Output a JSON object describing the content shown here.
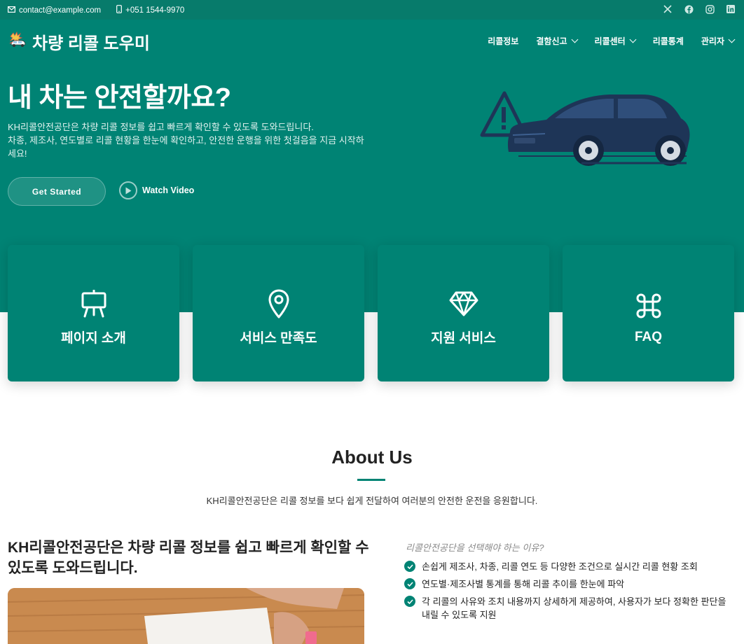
{
  "topbar": {
    "email": "contact@example.com",
    "phone": "+051 1544-9970",
    "social": [
      "x-icon",
      "facebook-icon",
      "instagram-icon",
      "linkedin-icon"
    ]
  },
  "brand": {
    "name": "차량 리콜 도우미",
    "logo_icon": "car-crash-icon"
  },
  "nav": [
    {
      "label": "리콜정보",
      "dropdown": false
    },
    {
      "label": "결함신고",
      "dropdown": true
    },
    {
      "label": "리콜센터",
      "dropdown": true
    },
    {
      "label": "리콜통계",
      "dropdown": false
    },
    {
      "label": "관리자",
      "dropdown": true
    }
  ],
  "hero": {
    "title": "내 차는 안전할까요?",
    "desc_line1": "KH리콜안전공단은 차량 리콜 정보를 쉽고 빠르게 확인할 수 있도록 도와드립니다.",
    "desc_line2": "차종, 제조사, 연도별로 리콜 현황을 한눈에 확인하고, 안전한 운행을 위한 첫걸음을 지금 시작하세요!",
    "cta": "Get Started",
    "video": "Watch Video"
  },
  "cards": [
    {
      "label": "페이지 소개",
      "icon": "easel-icon"
    },
    {
      "label": "서비스 만족도",
      "icon": "map-pin-icon"
    },
    {
      "label": "지원 서비스",
      "icon": "diamond-icon"
    },
    {
      "label": "FAQ",
      "icon": "command-icon"
    }
  ],
  "about": {
    "title": "About Us",
    "subtitle": "KH리콜안전공단은 리콜 정보를 보다 쉽게 전달하여 여러분의 안전한 운전을 응원합니다.",
    "headline": "KH리콜안전공단은 차량 리콜 정보를 쉽고 빠르게 확인할 수 있도록 도와드립니다.",
    "why": "리콜안전공단을 선택해야 하는 이유?",
    "points": [
      "손쉽게 제조사, 차종, 리콜 연도 등 다양한 조건으로 실시간 리콜 현황 조회",
      "연도별·제조사별 통계를 통해 리콜 추이를 한눈에 파악",
      "각 리콜의 사유와 조치 내용까지 상세하게 제공하여, 사용자가 보다 정확한 판단을 내릴 수 있도록 지원"
    ]
  },
  "colors": {
    "primary": "#008374",
    "topbar": "#077b6b",
    "car": "#1e3557"
  }
}
